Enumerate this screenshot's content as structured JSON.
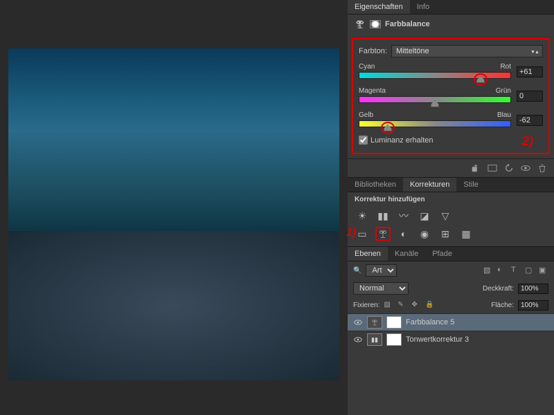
{
  "tabs_top": {
    "properties": "Eigenschaften",
    "info": "Info"
  },
  "panel_title": "Farbbalance",
  "tone_label": "Farbton:",
  "tone_value": "Mitteltöne",
  "sliders": {
    "cr": {
      "left": "Cyan",
      "right": "Rot",
      "value": "+61",
      "pos": 80
    },
    "mg": {
      "left": "Magenta",
      "right": "Grün",
      "value": "0",
      "pos": 50
    },
    "yb": {
      "left": "Gelb",
      "right": "Blau",
      "value": "-62",
      "pos": 19
    }
  },
  "preserve_lum": "Luminanz erhalten",
  "annotation_1": "1)",
  "annotation_2": "2)",
  "tabs_mid": {
    "lib": "Bibliotheken",
    "adj": "Korrekturen",
    "styles": "Stile"
  },
  "add_adjustment": "Korrektur hinzufügen",
  "tabs_layers": {
    "layers": "Ebenen",
    "channels": "Kanäle",
    "paths": "Pfade"
  },
  "layer_filter": "Art",
  "blend_mode": "Normal",
  "opacity_label": "Deckkraft:",
  "opacity_value": "100%",
  "lock_label": "Fixieren:",
  "fill_label": "Fläche:",
  "fill_value": "100%",
  "layers": [
    {
      "name": "Farbbalance 5"
    },
    {
      "name": "Tonwertkorrektur 3"
    }
  ]
}
